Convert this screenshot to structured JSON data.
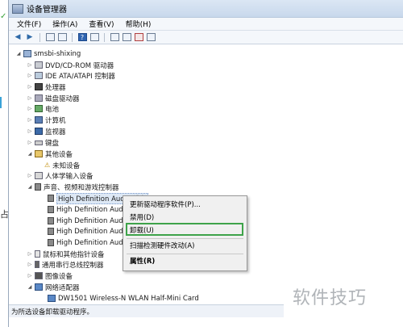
{
  "window": {
    "title": "设备管理器"
  },
  "menubar": {
    "items": [
      "文件(F)",
      "操作(A)",
      "查看(V)",
      "帮助(H)"
    ]
  },
  "tree": {
    "root": "smsbi-shixing",
    "items": [
      {
        "label": "DVD/CD-ROM 驱动器",
        "icon": "drive-icon"
      },
      {
        "label": "IDE ATA/ATAPI 控制器",
        "icon": "ide-icon"
      },
      {
        "label": "处理器",
        "icon": "cpu-icon"
      },
      {
        "label": "磁盘驱动器",
        "icon": "disk-icon"
      },
      {
        "label": "电池",
        "icon": "battery-icon"
      },
      {
        "label": "计算机",
        "icon": "computer-icon"
      },
      {
        "label": "监视器",
        "icon": "monitor-icon"
      },
      {
        "label": "键盘",
        "icon": "keyboard-icon"
      },
      {
        "label": "其他设备",
        "icon": "other-devices-icon"
      },
      {
        "label": "未知设备",
        "icon": "unknown-device-icon"
      },
      {
        "label": "人体学输入设备",
        "icon": "hid-icon"
      },
      {
        "label": "声音、视频和游戏控制器",
        "icon": "sound-icon"
      },
      {
        "label": "High Definition Audio 设备",
        "icon": "speaker-icon"
      },
      {
        "label": "High Definition Audi",
        "icon": "speaker-icon"
      },
      {
        "label": "High Definition Audi",
        "icon": "speaker-icon"
      },
      {
        "label": "High Definition Audi",
        "icon": "speaker-icon"
      },
      {
        "label": "High Definition Audi",
        "icon": "speaker-icon"
      },
      {
        "label": "鼠标和其他指针设备",
        "icon": "mouse-icon"
      },
      {
        "label": "通用串行总线控制器",
        "icon": "usb-icon"
      },
      {
        "label": "图像设备",
        "icon": "camera-icon"
      },
      {
        "label": "网络适配器",
        "icon": "network-icon"
      },
      {
        "label": "DW1501 Wireless-N WLAN Half-Mini Card",
        "icon": "network-card-icon"
      }
    ]
  },
  "context_menu": {
    "update_driver": "更新驱动程序软件(P)...",
    "disable": "禁用(D)",
    "uninstall": "卸载(U)",
    "scan": "扫描检测硬件改动(A)",
    "properties": "属性(R)"
  },
  "statusbar": {
    "text": "为所选设备卸载驱动程序。"
  },
  "watermark": "软件技巧",
  "colors": {
    "highlight_border": "#3ea34a",
    "titlebar": "#dbe6f4"
  }
}
